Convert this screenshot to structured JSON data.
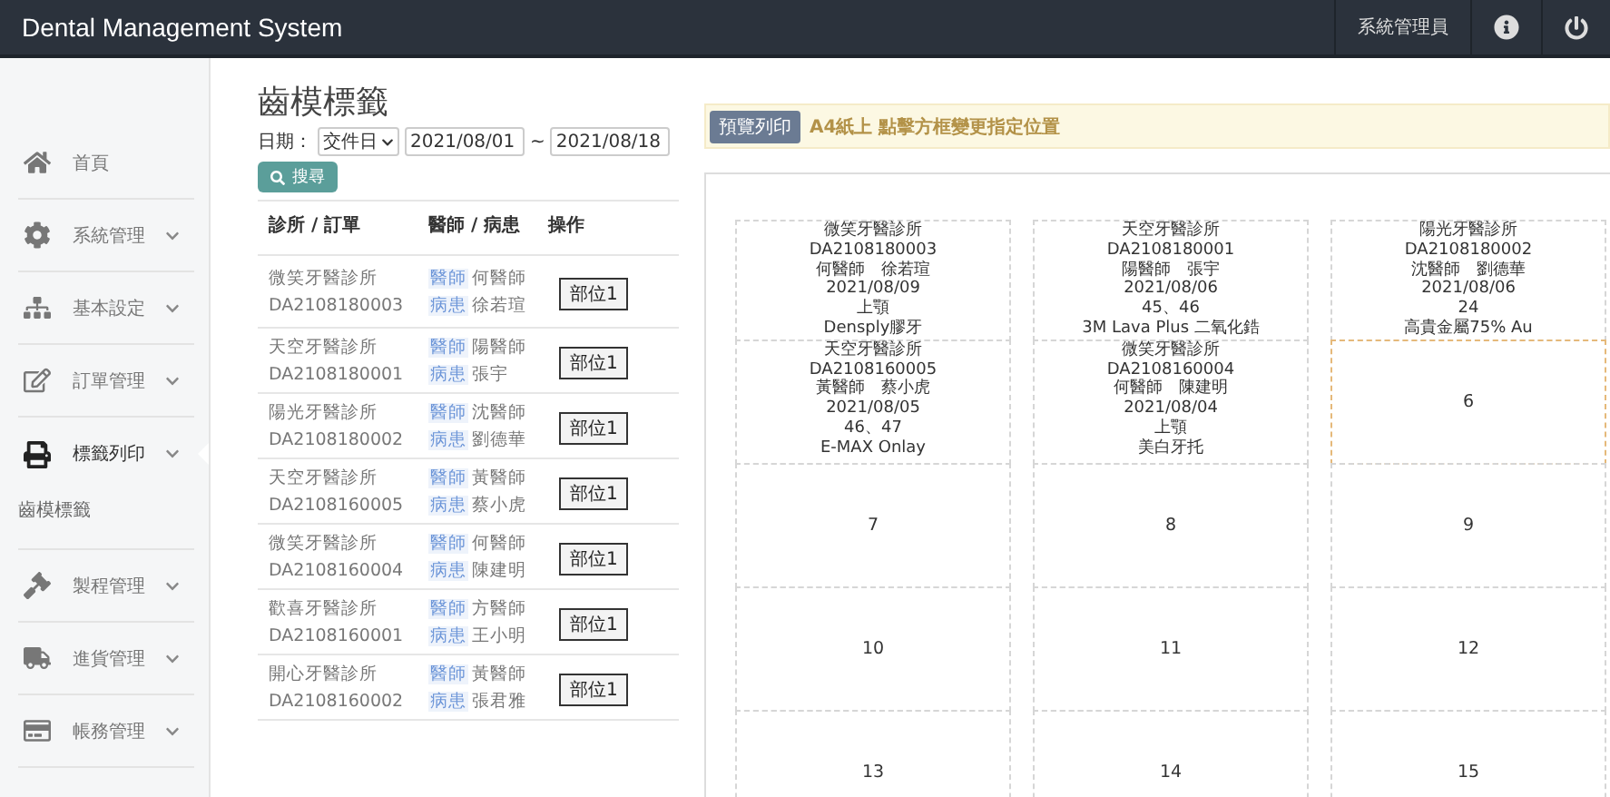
{
  "topbar": {
    "title": "Dental Management System",
    "user": "系統管理員"
  },
  "sidebar": {
    "items": [
      {
        "label": "首頁",
        "has_caret": false,
        "selected": false,
        "expanded": false
      },
      {
        "label": "系統管理",
        "has_caret": true,
        "selected": false,
        "expanded": false
      },
      {
        "label": "基本設定",
        "has_caret": true,
        "selected": false,
        "expanded": false
      },
      {
        "label": "訂單管理",
        "has_caret": true,
        "selected": false,
        "expanded": false
      },
      {
        "label": "標籤列印",
        "has_caret": true,
        "selected": true,
        "expanded": true,
        "children": [
          {
            "label": "齒模標籤"
          }
        ]
      },
      {
        "label": "製程管理",
        "has_caret": true,
        "selected": false,
        "expanded": false
      },
      {
        "label": "進貨管理",
        "has_caret": true,
        "selected": false,
        "expanded": false
      },
      {
        "label": "帳務管理",
        "has_caret": true,
        "selected": false,
        "expanded": false
      }
    ]
  },
  "page_title": "齒模標籤",
  "filter": {
    "label": "日期：",
    "date_type": "交件日",
    "from": "2021/08/01",
    "separator": "~",
    "to": "2021/08/18",
    "search_button": "搜尋"
  },
  "table": {
    "columns": [
      "診所 / 訂單",
      "醫師 / 病患",
      "操作"
    ],
    "rows": [
      {
        "clinic": "微笑牙醫診所",
        "order": "DA2108180003",
        "doctor_tag": "醫師",
        "doctor": "何醫師",
        "patient_tag": "病患",
        "patient": "徐若瑄",
        "action": "部位1"
      },
      {
        "clinic": "天空牙醫診所",
        "order": "DA2108180001",
        "doctor_tag": "醫師",
        "doctor": "陽醫師",
        "patient_tag": "病患",
        "patient": "張宇",
        "action": "部位1"
      },
      {
        "clinic": "陽光牙醫診所",
        "order": "DA2108180002",
        "doctor_tag": "醫師",
        "doctor": "沈醫師",
        "patient_tag": "病患",
        "patient": "劉德華",
        "action": "部位1"
      },
      {
        "clinic": "天空牙醫診所",
        "order": "DA2108160005",
        "doctor_tag": "醫師",
        "doctor": "黃醫師",
        "patient_tag": "病患",
        "patient": "蔡小虎",
        "action": "部位1"
      },
      {
        "clinic": "微笑牙醫診所",
        "order": "DA2108160004",
        "doctor_tag": "醫師",
        "doctor": "何醫師",
        "patient_tag": "病患",
        "patient": "陳建明",
        "action": "部位1"
      },
      {
        "clinic": "歡喜牙醫診所",
        "order": "DA2108160001",
        "doctor_tag": "醫師",
        "doctor": "方醫師",
        "patient_tag": "病患",
        "patient": "王小明",
        "action": "部位1"
      },
      {
        "clinic": "開心牙醫診所",
        "order": "DA2108160002",
        "doctor_tag": "醫師",
        "doctor": "黃醫師",
        "patient_tag": "病患",
        "patient": "張君雅",
        "action": "部位1"
      }
    ]
  },
  "notice": {
    "button": "預覽列印",
    "text": "A4紙上 點擊方框變更指定位置"
  },
  "sheet": {
    "cells": [
      {
        "kind": "label",
        "selected": false,
        "lines": [
          "微笑牙醫診所",
          "DA2108180003",
          "何醫師　徐若瑄",
          "2021/08/09",
          "上顎",
          "Densply膠牙"
        ]
      },
      {
        "kind": "label",
        "selected": false,
        "lines": [
          "天空牙醫診所",
          "DA2108180001",
          "陽醫師　張宇",
          "2021/08/06",
          "45、46",
          "3M Lava Plus 二氧化鋯"
        ]
      },
      {
        "kind": "label",
        "selected": false,
        "lines": [
          "陽光牙醫診所",
          "DA2108180002",
          "沈醫師　劉德華",
          "2021/08/06",
          "24",
          "高貴金屬75% Au"
        ]
      },
      {
        "kind": "label",
        "selected": false,
        "lines": [
          "天空牙醫診所",
          "DA2108160005",
          "黃醫師　蔡小虎",
          "2021/08/05",
          "46、47",
          "E-MAX Onlay"
        ]
      },
      {
        "kind": "label",
        "selected": false,
        "lines": [
          "微笑牙醫診所",
          "DA2108160004",
          "何醫師　陳建明",
          "2021/08/04",
          "上顎",
          "美白牙托"
        ]
      },
      {
        "kind": "empty",
        "selected": true,
        "number": "6"
      },
      {
        "kind": "empty",
        "selected": false,
        "number": "7"
      },
      {
        "kind": "empty",
        "selected": false,
        "number": "8"
      },
      {
        "kind": "empty",
        "selected": false,
        "number": "9"
      },
      {
        "kind": "empty",
        "selected": false,
        "number": "10"
      },
      {
        "kind": "empty",
        "selected": false,
        "number": "11"
      },
      {
        "kind": "empty",
        "selected": false,
        "number": "12"
      },
      {
        "kind": "empty",
        "selected": false,
        "number": "13"
      },
      {
        "kind": "empty",
        "selected": false,
        "number": "14"
      },
      {
        "kind": "empty",
        "selected": false,
        "number": "15"
      }
    ]
  }
}
